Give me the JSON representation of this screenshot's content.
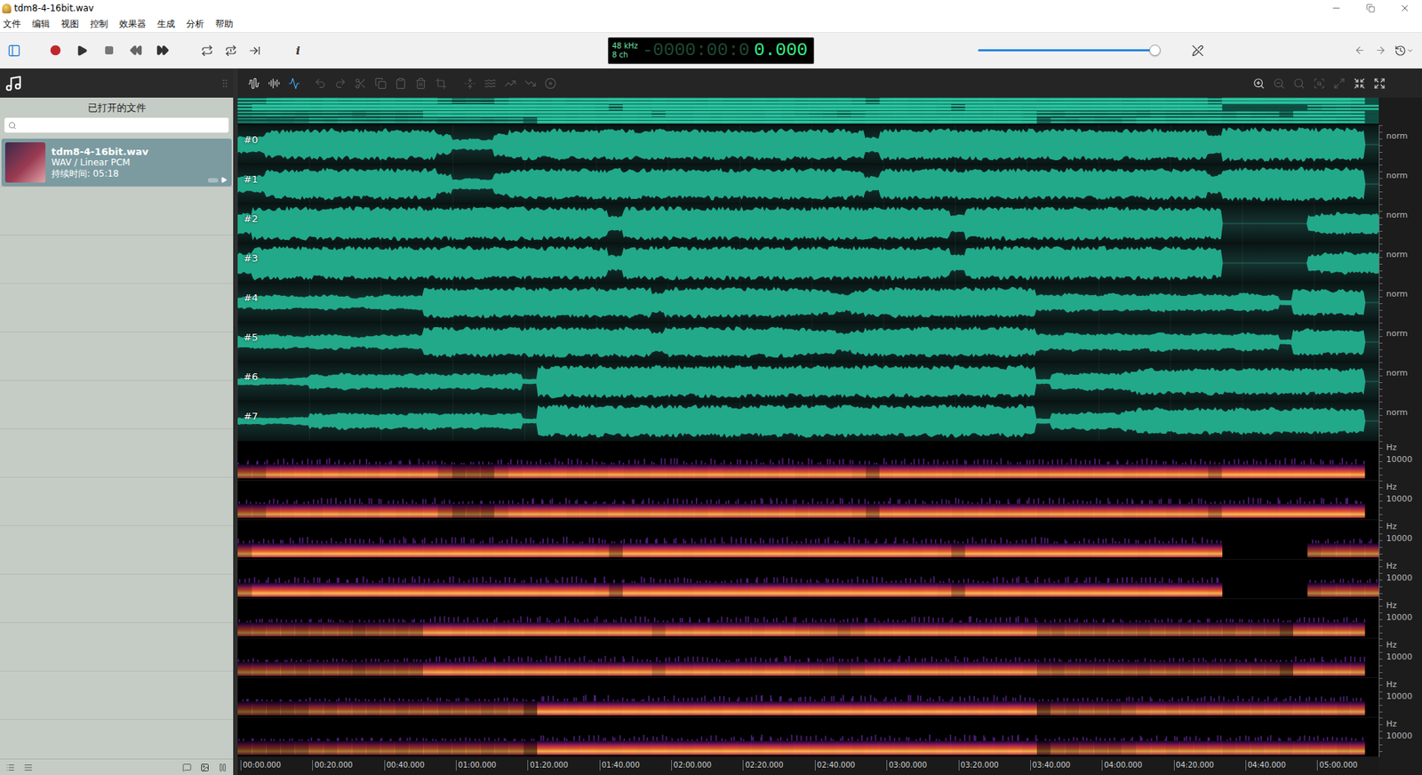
{
  "window": {
    "title": "tdm8-4-16bit.wav"
  },
  "menu": [
    "文件",
    "编辑",
    "视图",
    "控制",
    "效果器",
    "生成",
    "分析",
    "帮助"
  ],
  "toolbar": {
    "sidebar_toggle": {
      "selected": true
    },
    "info_label": "i",
    "display": {
      "rate": "48 kHz",
      "channels": "8 ch",
      "time_dim": "-0000:00:0",
      "time": "0.000"
    },
    "volume": {
      "level": 0.97
    }
  },
  "sidebar": {
    "title": "已打开的文件",
    "files": [
      {
        "name": "tdm8-4-16bit.wav",
        "format": "WAV / Linear PCM",
        "duration": "持续时间: 05:18",
        "selected": true
      }
    ]
  },
  "edit_tools": {
    "view_modes": [
      {
        "selected": false
      },
      {
        "selected": false
      },
      {
        "selected": true
      }
    ],
    "edit": [
      {
        "enabled": false
      },
      {
        "enabled": false
      },
      {
        "enabled": false
      },
      {
        "enabled": false
      },
      {
        "enabled": false
      },
      {
        "enabled": false
      },
      {
        "enabled": false
      }
    ],
    "effects": [
      {
        "enabled": false
      },
      {
        "enabled": false
      },
      {
        "enabled": false
      },
      {
        "enabled": false
      },
      {
        "enabled": false
      }
    ],
    "zoom": [
      {
        "enabled": true
      },
      {
        "enabled": false
      },
      {
        "enabled": false
      },
      {
        "enabled": false
      },
      {
        "enabled": false
      },
      {
        "enabled": true
      },
      {
        "enabled": true
      }
    ]
  },
  "editor": {
    "duration_seconds": 318,
    "time_ticks": [
      "00:00.000",
      "00:20.000",
      "00:40.000",
      "01:00.000",
      "01:20.000",
      "01:40.000",
      "02:00.000",
      "02:20.000",
      "02:40.000",
      "03:00.000",
      "03:20.000",
      "03:40.000",
      "04:00.000",
      "04:20.000",
      "04:40.000",
      "05:00.000"
    ],
    "channels": [
      {
        "label": "#0",
        "scale": "norm",
        "spectrum_unit": "Hz",
        "spectrum_tick": "10000",
        "envelope": [
          0.5,
          0.5,
          0.8,
          0.85,
          0.88,
          0.85,
          0.9,
          0.85,
          0.87,
          0.85,
          0.9,
          0.86,
          0.85,
          0.88,
          0.6,
          0.3,
          0.35,
          0.3,
          0.7,
          0.85,
          0.88,
          0.86,
          0.9,
          0.85,
          0.87,
          0.85,
          0.9,
          0.86,
          0.85,
          0.88,
          0.86,
          0.87,
          0.85,
          0.9,
          0.86,
          0.85,
          0.88,
          0.86,
          0.9,
          0.85,
          0.87,
          0.86,
          0.88,
          0.8,
          0.45,
          0.88,
          0.9,
          0.87,
          0.88,
          0.9,
          0.86,
          0.88,
          0.9,
          0.87,
          0.88,
          0.9,
          0.86,
          0.88,
          0.9,
          0.87,
          0.88,
          0.9,
          0.86,
          0.88,
          0.9,
          0.87,
          0.88,
          0.85,
          0.55,
          0.95,
          0.95,
          0.96,
          0.95,
          0.95,
          0.96,
          0.95,
          0.95,
          0.96,
          0.9,
          0
        ]
      },
      {
        "label": "#1",
        "scale": "norm",
        "spectrum_unit": "Hz",
        "spectrum_tick": "10000",
        "envelope": [
          0.5,
          0.5,
          0.8,
          0.85,
          0.88,
          0.85,
          0.9,
          0.85,
          0.87,
          0.85,
          0.9,
          0.86,
          0.85,
          0.88,
          0.6,
          0.3,
          0.35,
          0.3,
          0.7,
          0.85,
          0.88,
          0.86,
          0.9,
          0.85,
          0.87,
          0.85,
          0.9,
          0.86,
          0.85,
          0.88,
          0.86,
          0.87,
          0.85,
          0.9,
          0.86,
          0.85,
          0.88,
          0.86,
          0.9,
          0.85,
          0.87,
          0.86,
          0.88,
          0.8,
          0.45,
          0.88,
          0.9,
          0.87,
          0.88,
          0.9,
          0.86,
          0.88,
          0.9,
          0.87,
          0.88,
          0.9,
          0.86,
          0.88,
          0.9,
          0.87,
          0.88,
          0.9,
          0.86,
          0.88,
          0.9,
          0.87,
          0.88,
          0.85,
          0.55,
          0.95,
          0.95,
          0.96,
          0.95,
          0.95,
          0.96,
          0.95,
          0.95,
          0.96,
          0.9,
          0
        ]
      },
      {
        "label": "#2",
        "scale": "norm",
        "spectrum_unit": "Hz",
        "spectrum_tick": "10000",
        "envelope": [
          0.6,
          0.95,
          0.94,
          0.96,
          0.95,
          0.93,
          0.95,
          0.96,
          0.95,
          0.94,
          0.95,
          0.96,
          0.95,
          0.93,
          0.95,
          0.96,
          0.95,
          0.94,
          0.95,
          0.96,
          0.95,
          0.93,
          0.95,
          0.96,
          0.95,
          0.9,
          0.45,
          0.95,
          0.94,
          0.96,
          0.95,
          0.93,
          0.95,
          0.96,
          0.95,
          0.94,
          0.95,
          0.96,
          0.95,
          0.93,
          0.95,
          0.96,
          0.95,
          0.94,
          0.95,
          0.96,
          0.95,
          0.93,
          0.95,
          0.9,
          0.5,
          0.95,
          0.94,
          0.96,
          0.95,
          0.93,
          0.95,
          0.96,
          0.95,
          0.94,
          0.95,
          0.96,
          0.95,
          0.93,
          0.95,
          0.96,
          0.95,
          0.94,
          0.9,
          0,
          0,
          0,
          0,
          0,
          0,
          0.5,
          0.6,
          0.65,
          0.6,
          0.6
        ]
      },
      {
        "label": "#3",
        "scale": "norm",
        "spectrum_unit": "Hz",
        "spectrum_tick": "10000",
        "envelope": [
          0.6,
          0.95,
          0.94,
          0.96,
          0.95,
          0.93,
          0.95,
          0.96,
          0.95,
          0.94,
          0.95,
          0.96,
          0.95,
          0.93,
          0.95,
          0.96,
          0.95,
          0.94,
          0.95,
          0.96,
          0.95,
          0.93,
          0.95,
          0.96,
          0.95,
          0.9,
          0.45,
          0.95,
          0.94,
          0.96,
          0.95,
          0.93,
          0.95,
          0.96,
          0.95,
          0.94,
          0.95,
          0.96,
          0.95,
          0.93,
          0.95,
          0.96,
          0.95,
          0.94,
          0.95,
          0.96,
          0.95,
          0.93,
          0.95,
          0.9,
          0.5,
          0.95,
          0.94,
          0.96,
          0.95,
          0.93,
          0.95,
          0.96,
          0.95,
          0.94,
          0.95,
          0.96,
          0.95,
          0.93,
          0.95,
          0.96,
          0.95,
          0.94,
          0.9,
          0,
          0,
          0,
          0,
          0,
          0,
          0.5,
          0.6,
          0.65,
          0.6,
          0.6
        ]
      },
      {
        "label": "#4",
        "scale": "norm",
        "spectrum_unit": "Hz",
        "spectrum_tick": "10000",
        "envelope": [
          0.35,
          0.4,
          0.45,
          0.4,
          0.35,
          0.42,
          0.45,
          0.4,
          0.3,
          0.4,
          0.45,
          0.42,
          0.45,
          0.85,
          0.88,
          0.84,
          0.86,
          0.88,
          0.85,
          0.87,
          0.84,
          0.86,
          0.88,
          0.85,
          0.87,
          0.84,
          0.86,
          0.88,
          0.85,
          0.6,
          0.86,
          0.84,
          0.88,
          0.85,
          0.87,
          0.86,
          0.84,
          0.88,
          0.85,
          0.8,
          0.75,
          0.7,
          0.55,
          0.7,
          0.82,
          0.86,
          0.88,
          0.85,
          0.87,
          0.84,
          0.86,
          0.88,
          0.85,
          0.87,
          0.86,
          0.8,
          0.5,
          0.45,
          0.55,
          0.5,
          0.48,
          0.52,
          0.5,
          0.45,
          0.55,
          0.5,
          0.48,
          0.52,
          0.5,
          0.45,
          0.55,
          0.5,
          0.48,
          0.15,
          0.75,
          0.78,
          0.75,
          0.77,
          0.72,
          0
        ]
      },
      {
        "label": "#5",
        "scale": "norm",
        "spectrum_unit": "Hz",
        "spectrum_tick": "10000",
        "envelope": [
          0.35,
          0.4,
          0.45,
          0.4,
          0.35,
          0.42,
          0.45,
          0.4,
          0.3,
          0.4,
          0.45,
          0.42,
          0.45,
          0.85,
          0.88,
          0.84,
          0.86,
          0.88,
          0.85,
          0.87,
          0.84,
          0.86,
          0.88,
          0.85,
          0.87,
          0.84,
          0.86,
          0.88,
          0.85,
          0.6,
          0.86,
          0.84,
          0.88,
          0.85,
          0.87,
          0.86,
          0.84,
          0.88,
          0.85,
          0.8,
          0.75,
          0.7,
          0.55,
          0.7,
          0.82,
          0.86,
          0.88,
          0.85,
          0.87,
          0.84,
          0.86,
          0.88,
          0.85,
          0.87,
          0.86,
          0.8,
          0.5,
          0.45,
          0.55,
          0.5,
          0.48,
          0.52,
          0.5,
          0.45,
          0.55,
          0.5,
          0.48,
          0.52,
          0.5,
          0.45,
          0.55,
          0.5,
          0.48,
          0.15,
          0.75,
          0.78,
          0.75,
          0.77,
          0.72,
          0
        ]
      },
      {
        "label": "#6",
        "scale": "norm",
        "spectrum_unit": "Hz",
        "spectrum_tick": "10000",
        "envelope": [
          0.2,
          0.22,
          0.18,
          0.2,
          0.25,
          0.45,
          0.4,
          0.5,
          0.45,
          0.42,
          0.48,
          0.4,
          0.45,
          0.5,
          0.42,
          0.45,
          0.48,
          0.4,
          0.45,
          0.5,
          0.15,
          0.9,
          0.92,
          0.9,
          0.93,
          0.91,
          0.9,
          0.92,
          0.9,
          0.93,
          0.91,
          0.9,
          0.92,
          0.9,
          0.93,
          0.91,
          0.9,
          0.92,
          0.9,
          0.93,
          0.91,
          0.9,
          0.92,
          0.9,
          0.93,
          0.91,
          0.9,
          0.92,
          0.9,
          0.93,
          0.91,
          0.9,
          0.92,
          0.9,
          0.93,
          0.88,
          0.15,
          0.5,
          0.45,
          0.55,
          0.5,
          0.48,
          0.6,
          0.75,
          0.78,
          0.72,
          0.76,
          0.75,
          0.78,
          0.72,
          0.76,
          0.75,
          0.78,
          0.72,
          0.76,
          0.75,
          0.78,
          0.72,
          0.76,
          0
        ]
      },
      {
        "label": "#7",
        "scale": "norm",
        "spectrum_unit": "Hz",
        "spectrum_tick": "10000",
        "envelope": [
          0.2,
          0.22,
          0.18,
          0.2,
          0.25,
          0.45,
          0.4,
          0.5,
          0.45,
          0.42,
          0.48,
          0.4,
          0.45,
          0.5,
          0.42,
          0.45,
          0.48,
          0.4,
          0.45,
          0.5,
          0.15,
          0.9,
          0.92,
          0.9,
          0.93,
          0.91,
          0.9,
          0.92,
          0.9,
          0.93,
          0.91,
          0.9,
          0.92,
          0.9,
          0.93,
          0.91,
          0.9,
          0.92,
          0.9,
          0.93,
          0.91,
          0.9,
          0.92,
          0.9,
          0.93,
          0.91,
          0.9,
          0.92,
          0.9,
          0.93,
          0.91,
          0.9,
          0.92,
          0.9,
          0.93,
          0.88,
          0.15,
          0.5,
          0.45,
          0.55,
          0.5,
          0.48,
          0.6,
          0.75,
          0.78,
          0.72,
          0.76,
          0.75,
          0.78,
          0.72,
          0.76,
          0.75,
          0.78,
          0.72,
          0.76,
          0.75,
          0.78,
          0.72,
          0.76,
          0
        ]
      }
    ]
  }
}
